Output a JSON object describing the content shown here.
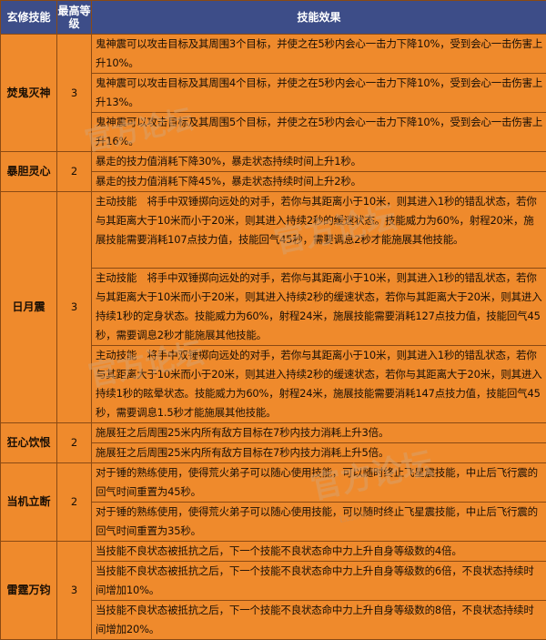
{
  "header": {
    "col_skill": "玄修技能",
    "col_max_level": "最高等级",
    "col_effect": "技能效果"
  },
  "skills": [
    {
      "name": "焚鬼灭神",
      "max_level": "3",
      "effects": [
        "鬼神震可以攻击目标及其周围3个目标，并使之在5秒内会心一击力下降10%，受到会心一击伤害上升10%。",
        "鬼神震可以攻击目标及其周围4个目标，并使之在5秒内会心一击力下降10%，受到会心一击伤害上升13%。",
        "鬼神震可以攻击目标及其周围5个目标，并使之在5秒内会心一击力下降10%，受到会心一击伤害上升16%。"
      ]
    },
    {
      "name": "暴胆灵心",
      "max_level": "2",
      "effects": [
        "暴走的技力值消耗下降30%，暴走状态持续时间上升1秒。",
        "暴走的技力值消耗下降45%，暴走状态持续时间上升2秒。"
      ]
    },
    {
      "name": "日月震",
      "max_level": "3",
      "effects": [
        "主动技能　将手中双锤掷向远处的对手，若你与其距离小于10米，则其进入1秒的错乱状态，若你与其距离大于10米而小于20米，则其进入持续2秒的缓速状态。技能威力为60%，射程20米，施展技能需要消耗107点技力值，技能回气45秒，需要调息2秒才能施展其他技能。",
        "主动技能　将手中双锤掷向远处的对手，若你与其距离小于10米，则其进入1秒的错乱状态，若你与其距离大于10米而小于20米，则其进入持续2秒的缓速状态，若你与其距离大于20米，则其进入持续1秒的定身状态。技能威力为60%，射程24米，施展技能需要消耗127点技力值，技能回气45秒，需要调息2秒才能施展其他技能。",
        "主动技能　将手中双锤掷向远处的对手，若你与其距离小于10米，则其进入1秒的错乱状态，若你与其距离大于10米而小于20米，则其进入持续2秒的缓速状态，若你与其距离大于20米，则其进入持续1秒的眩晕状态。技能威力为60%，射程24米，施展技能需要消耗147点技力值，技能回气45秒，需要调息1.5秒才能施展其他技能。"
      ]
    },
    {
      "name": "狂心饮恨",
      "max_level": "2",
      "effects": [
        "施展狂之后周围25米内所有敌方目标在7秒内技力消耗上升3倍。",
        "施展狂之后周围25米内所有敌方目标在7秒内技力消耗上升5倍。"
      ]
    },
    {
      "name": "当机立断",
      "max_level": "2",
      "effects": [
        "对于锤的熟练使用，使得荒火弟子可以随心使用技能，可以随时终止飞星震技能，中止后飞行震的回气时间重置为45秒。",
        "对于锤的熟练使用，使得荒火弟子可以随心使用技能，可以随时终止飞星震技能，中止后飞行震的回气时间重置为35秒。"
      ]
    },
    {
      "name": "雷霆万钧",
      "max_level": "3",
      "effects": [
        "当技能不良状态被抵抗之后，下一个技能不良状态命中力上升自身等级数的4倍。",
        "当技能不良状态被抵抗之后，下一个技能不良状态命中力上升自身等级数的6倍，不良状态持续时间增加10%。",
        "当技能不良状态被抵抗之后，下一个技能不良状态命中力上升自身等级数的8倍，不良状态持续时间增加20%。"
      ]
    }
  ],
  "watermarks": {
    "logo_text": "官方论坛",
    "logo_short": "天3",
    "url_text": "tx3.n..."
  }
}
